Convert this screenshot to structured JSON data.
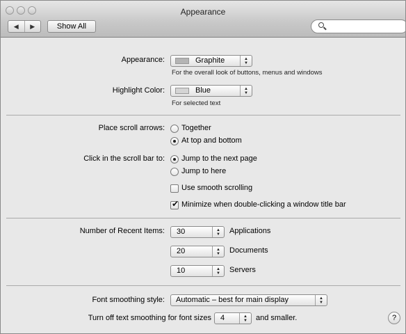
{
  "window": {
    "title": "Appearance"
  },
  "toolbar": {
    "back_icon": "◀",
    "forward_icon": "▶",
    "show_all": "Show All",
    "search_placeholder": ""
  },
  "appearance": {
    "label": "Appearance:",
    "value": "Graphite",
    "swatch_color": "#b4b4b4",
    "note": "For the overall look of buttons, menus and windows"
  },
  "highlight": {
    "label": "Highlight Color:",
    "value": "Blue",
    "swatch_color": "#d4d4d4",
    "note": "For selected text"
  },
  "scroll_arrows": {
    "label": "Place scroll arrows:",
    "options": [
      "Together",
      "At top and bottom"
    ],
    "selected": 1
  },
  "scroll_click": {
    "label": "Click in the scroll bar to:",
    "options": [
      "Jump to the next page",
      "Jump to here"
    ],
    "selected": 0
  },
  "smooth_scrolling": {
    "label": "Use smooth scrolling",
    "checked": false
  },
  "minimize": {
    "label": "Minimize when double-clicking a window title bar",
    "checked": true
  },
  "recent": {
    "label": "Number of Recent Items:",
    "items": [
      {
        "value": "30",
        "label": "Applications"
      },
      {
        "value": "20",
        "label": "Documents"
      },
      {
        "value": "10",
        "label": "Servers"
      }
    ]
  },
  "font_smoothing": {
    "label": "Font smoothing style:",
    "value": "Automatic – best for main display"
  },
  "text_smoothing": {
    "prefix": "Turn off text smoothing for font sizes",
    "value": "4",
    "suffix": "and smaller."
  },
  "help": "?"
}
